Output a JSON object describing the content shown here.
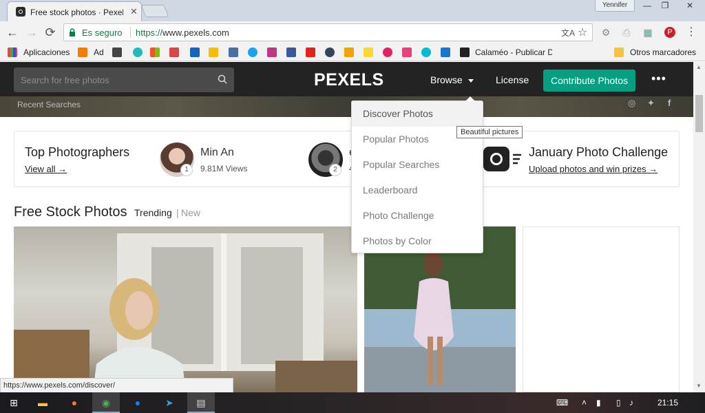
{
  "browser": {
    "tab_title": "Free stock photos · Pexel",
    "tab_close": "✕",
    "user": "Yennifer",
    "window_min": "—",
    "window_restore": "❐",
    "window_close": "✕",
    "back": "←",
    "forward": "→",
    "reload": "⟳",
    "secure_label": "Es seguro",
    "url_scheme": "https://",
    "url_host": "www.pexels.com",
    "menu": "⋮"
  },
  "bookmarks": {
    "apps_label": "Aplicaciones",
    "ad_label": "Ad",
    "calameo_label": "Calaméo - Publicar D",
    "other_label": "Otros marcadores"
  },
  "navbar": {
    "search_placeholder": "Search for free photos",
    "logo": "PEXELS",
    "browse": "Browse",
    "license": "License",
    "contribute": "Contribute Photos",
    "more": "•••",
    "recent_searches": "Recent Searches"
  },
  "top_photographers": {
    "title": "Top Photographers",
    "view_all": "View all →",
    "people": [
      {
        "rank": "1",
        "name": "Min An",
        "views": "9.81M Views"
      },
      {
        "rank": "2",
        "name": "e",
        "views": "4"
      }
    ]
  },
  "challenge": {
    "title": "January Photo Challenge",
    "link": "Upload photos and win prizes →"
  },
  "feed": {
    "title": "Free Stock Photos",
    "trending": "Trending",
    "divider": "|",
    "new": "New"
  },
  "dropdown": {
    "items": [
      "Discover Photos",
      "Popular Photos",
      "Popular Searches",
      "Leaderboard",
      "Photo Challenge",
      "Photos by Color"
    ]
  },
  "tooltip": "Beautiful pictures",
  "status_url": "https://www.pexels.com/discover/",
  "taskbar": {
    "time": "21:15"
  },
  "colors": {
    "accent_green": "#05a081",
    "navbar_bg": "#232323",
    "secure_green": "#0b8043"
  }
}
